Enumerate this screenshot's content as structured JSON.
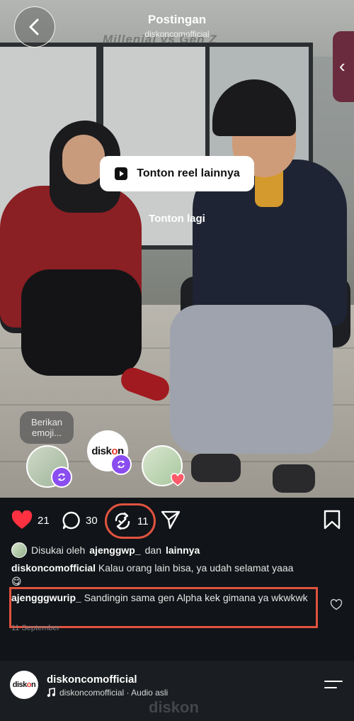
{
  "header": {
    "title": "Postingan",
    "username": "diskoncomofficial",
    "video_caption": "Millenial vs Gen Z"
  },
  "overlay": {
    "watch_more_label": "Tonton reel lainnya",
    "replay_label": "Tonton lagi"
  },
  "emoji_prompt": "Berikan emoji...",
  "logo": {
    "prefix": "disk",
    "accent": "o",
    "suffix": "n",
    "tld": ".com"
  },
  "actions": {
    "likes": "21",
    "comments": "30",
    "reposts": "11"
  },
  "liked_by": {
    "prefix": "Disukai oleh",
    "user": "ajenggwp_",
    "connector": "dan",
    "others": "lainnya"
  },
  "caption": {
    "user": "diskoncomofficial",
    "text": "Kalau orang lain bisa, ya udah selamat yaaa",
    "emoji": "😋"
  },
  "top_comment": {
    "user": "ajengggwurip_",
    "text": "Sandingin sama gen Alpha kek gimana ya wkwkwk"
  },
  "date": "11 September",
  "player": {
    "username": "diskoncomofficial",
    "audio": "diskoncomofficial · Audio asli"
  },
  "colors": {
    "like_red": "#ff3040",
    "annotation": "#e0533f",
    "badge_purple": "#8a4df0",
    "panel_bg": "#111418"
  }
}
